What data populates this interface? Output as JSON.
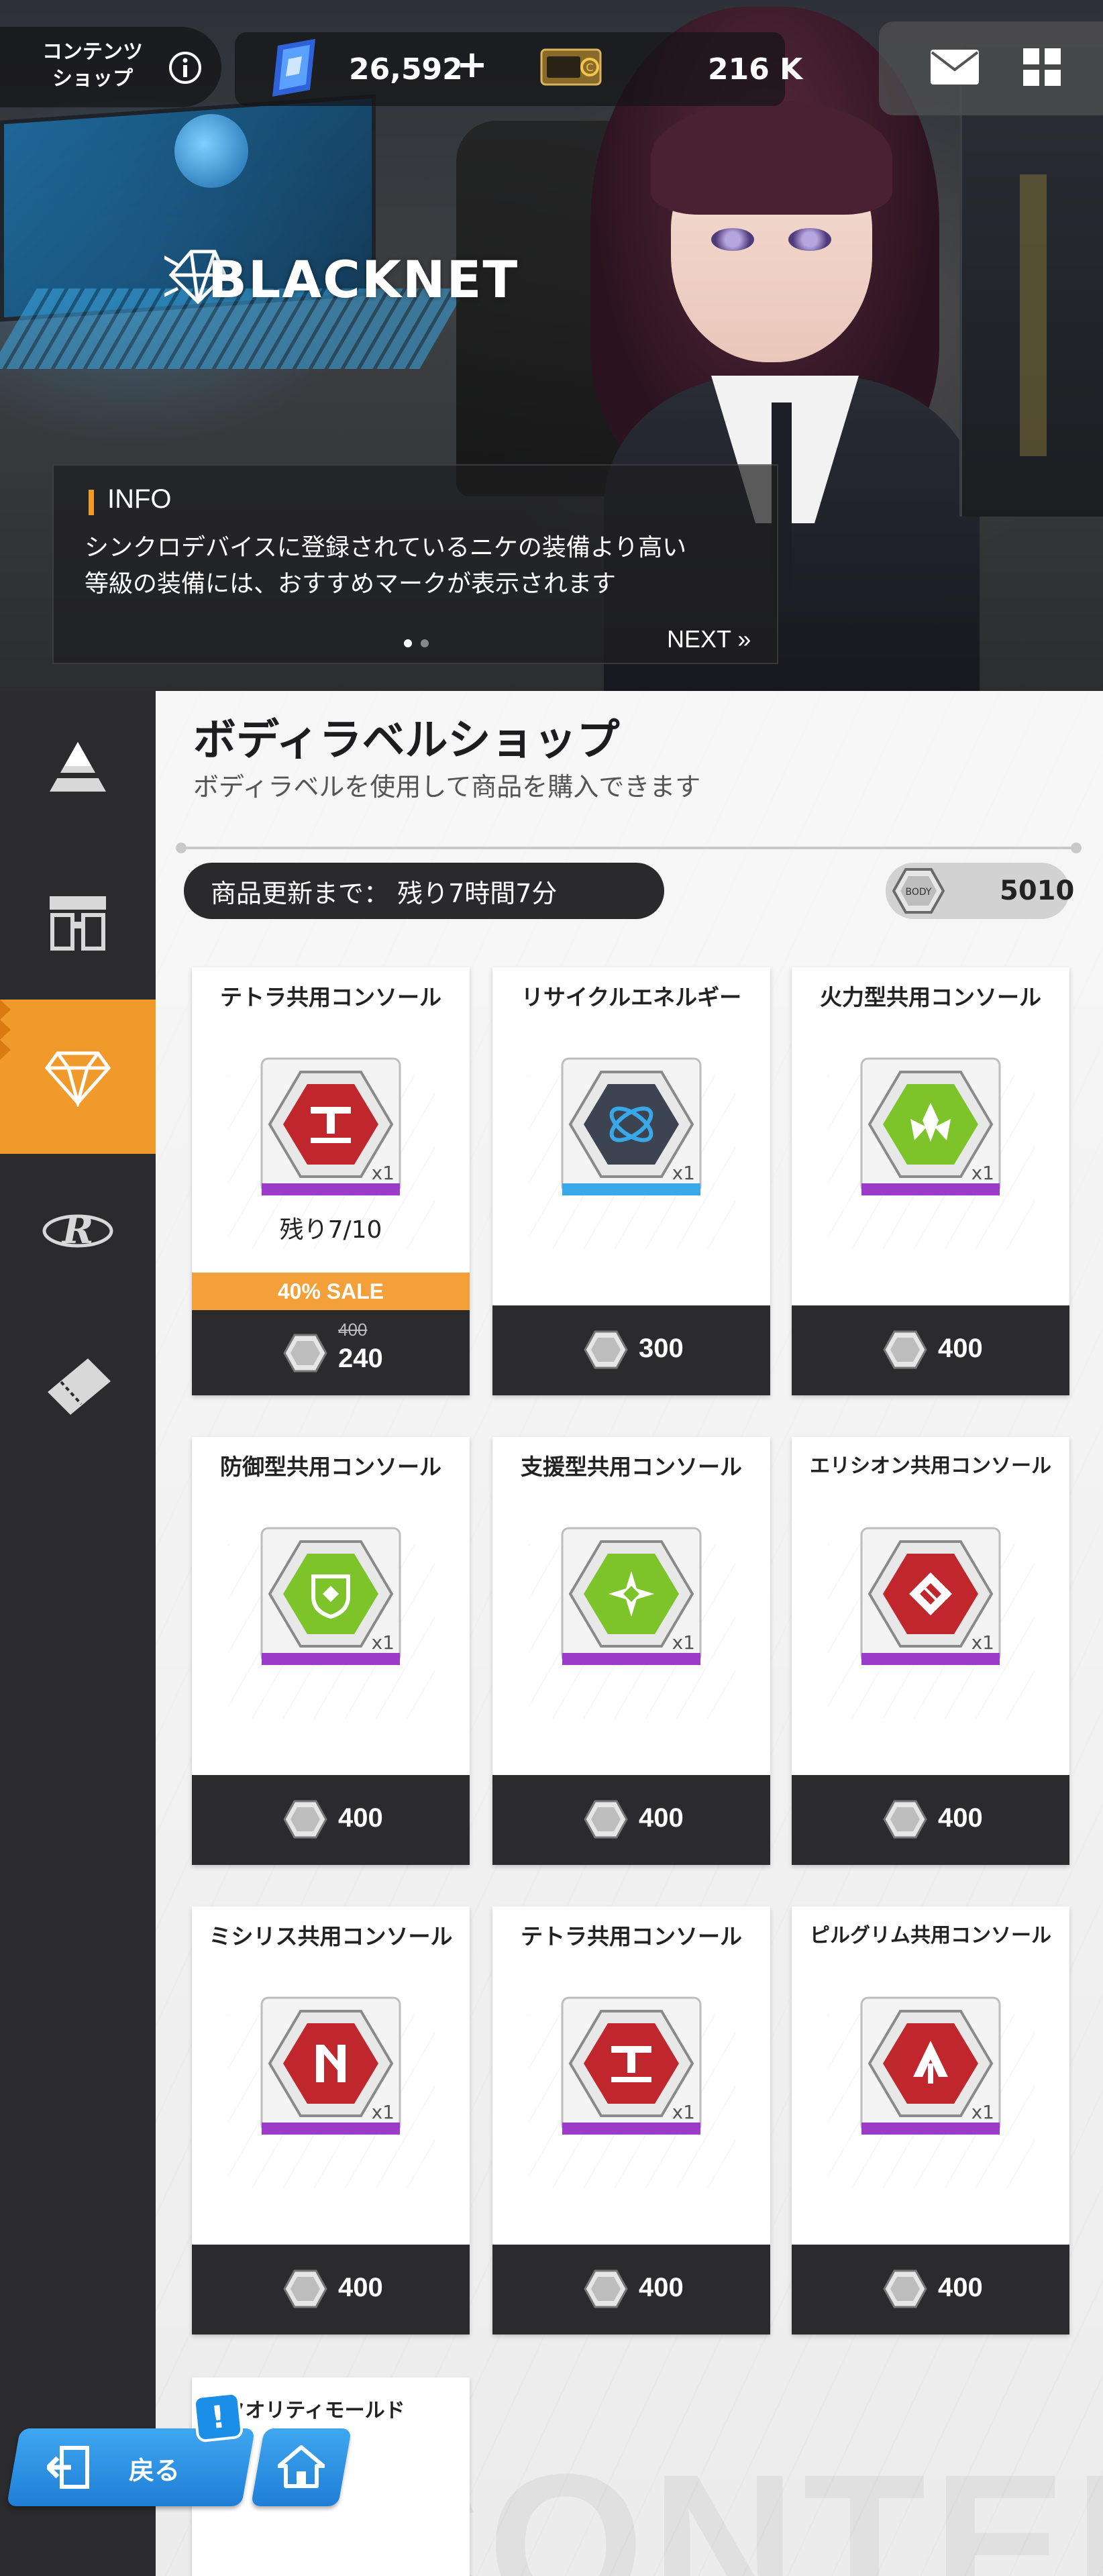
{
  "header": {
    "content_shop_label_line1": "コンテンツ",
    "content_shop_label_line2": "ショップ",
    "gems_value": "26,592",
    "gems_plus": "+",
    "credits_value": "216 K"
  },
  "banner": {
    "logo_text": "BLACKNET",
    "info_title": "INFO",
    "info_text_line1": "シンクロデバイスに登録されているニケの装備より高い",
    "info_text_line2": "等級の装備には、おすすめマークが表示されます",
    "next_label": "NEXT »",
    "page_count": 2,
    "current_page": 1
  },
  "shop": {
    "title": "ボディラベルショップ",
    "subtitle": "ボディラベルを使用して商品を購入できます",
    "refresh_label": "商品更新まで： 残り7時間7分",
    "balance": "5010"
  },
  "items": [
    {
      "name": "テトラ共用コンソール",
      "stock": "残り7/10",
      "sale": "40% SALE",
      "old_price": "400",
      "price": "240",
      "color": "#c0272d",
      "bar": "#9a3cc7",
      "icon": "tetra-console-icon"
    },
    {
      "name": "リサイクルエネルギー",
      "price": "300",
      "color": "#3b4450",
      "bar": "#3aa7e8",
      "icon": "recycle-energy-icon"
    },
    {
      "name": "火力型共用コンソール",
      "price": "400",
      "color": "#7cc42a",
      "bar": "#9a3cc7",
      "icon": "firepower-console-icon"
    },
    {
      "name": "防御型共用コンソール",
      "price": "400",
      "color": "#7cc42a",
      "bar": "#9a3cc7",
      "icon": "defense-console-icon"
    },
    {
      "name": "支援型共用コンソール",
      "price": "400",
      "color": "#7cc42a",
      "bar": "#9a3cc7",
      "icon": "support-console-icon"
    },
    {
      "name": "エリシオン共用コンソール",
      "price": "400",
      "color": "#c0272d",
      "bar": "#9a3cc7",
      "icon": "elysion-console-icon"
    },
    {
      "name": "ミシリス共用コンソール",
      "price": "400",
      "color": "#c0272d",
      "bar": "#9a3cc7",
      "icon": "missilis-console-icon"
    },
    {
      "name": "テトラ共用コンソール",
      "price": "400",
      "color": "#c0272d",
      "bar": "#9a3cc7",
      "icon": "tetra-console-icon"
    },
    {
      "name": "ピルグリム共用コンソール",
      "price": "400",
      "color": "#c0272d",
      "bar": "#9a3cc7",
      "icon": "pilgrim-console-icon"
    }
  ],
  "partial_item": {
    "name": "イクオリティモールド"
  },
  "quantity_label": "x1",
  "watermark": "CONTENT",
  "nav": {
    "back_label": "戻る",
    "notification_badge": "!"
  },
  "sidebar": {
    "items": [
      {
        "icon": "pyramid-icon"
      },
      {
        "icon": "box-shop-icon"
      },
      {
        "icon": "diamond-icon",
        "active": true
      },
      {
        "icon": "r-emblem-icon"
      },
      {
        "icon": "ticket-icon"
      }
    ]
  },
  "colors": {
    "accent_orange": "#f19a2c",
    "sidebar_dark": "#2b2b2d",
    "back_button_blue": "#2e8fe0"
  }
}
